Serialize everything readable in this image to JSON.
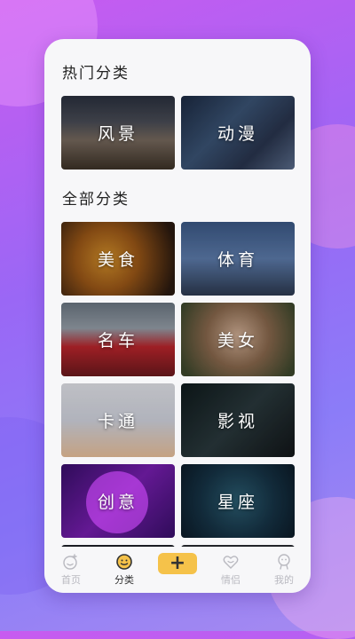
{
  "sections": {
    "hot_title": "热门分类",
    "all_title": "全部分类"
  },
  "hot": [
    {
      "label": "风景",
      "icon": "scenery-image"
    },
    {
      "label": "动漫",
      "icon": "anime-image"
    }
  ],
  "all": [
    {
      "label": "美食",
      "icon": "food-image"
    },
    {
      "label": "体育",
      "icon": "sports-image"
    },
    {
      "label": "名车",
      "icon": "car-image"
    },
    {
      "label": "美女",
      "icon": "beauty-image"
    },
    {
      "label": "卡通",
      "icon": "cartoon-image"
    },
    {
      "label": "影视",
      "icon": "film-image"
    },
    {
      "label": "创意",
      "icon": "creative-image"
    },
    {
      "label": "星座",
      "icon": "zodiac-image"
    }
  ],
  "tabbar": {
    "home": "首页",
    "category": "分类",
    "add": "+",
    "couple": "情侣",
    "mine": "我的"
  },
  "colors": {
    "accent": "#f5c24a",
    "inactive": "#b9b9c0",
    "active": "#333333"
  }
}
